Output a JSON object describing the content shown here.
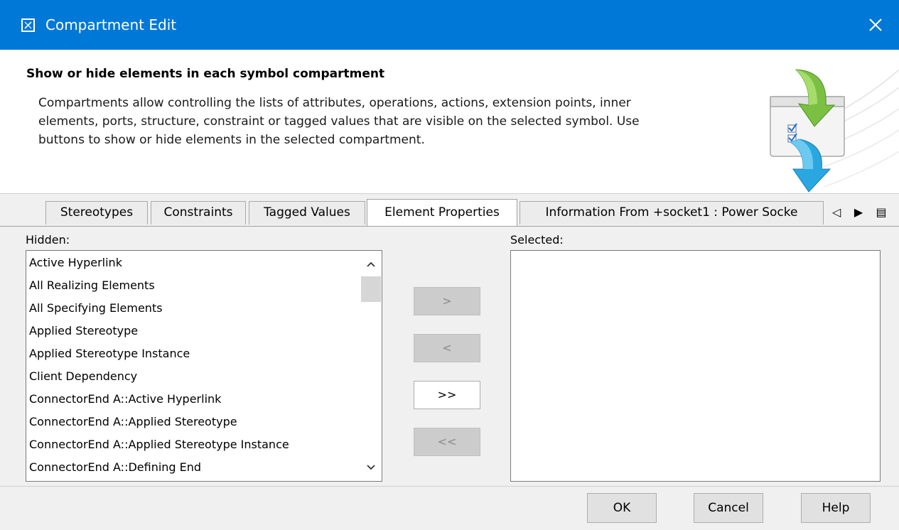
{
  "window": {
    "title": "Compartment Edit",
    "close_glyph": "✕"
  },
  "header": {
    "title": "Show or hide elements in each symbol compartment",
    "description_lines": [
      "Compartments allow controlling the lists of attributes, operations, actions, extension points, inner",
      "elements, ports, structure, constraint or tagged values that are visible on the selected symbol. Use",
      "buttons to show or hide elements in the selected compartment."
    ]
  },
  "tabs": [
    {
      "label": "Stereotypes",
      "active": false
    },
    {
      "label": "Constraints",
      "active": false
    },
    {
      "label": "Tagged Values",
      "active": false
    },
    {
      "label": "Element Properties",
      "active": true
    },
    {
      "label": "Information From +socket1 : Power Socke",
      "active": false
    }
  ],
  "tab_nav": {
    "prev_glyph": "◁",
    "next_glyph": "▶",
    "menu_glyph": "▤"
  },
  "hidden": {
    "label": "Hidden:",
    "items": [
      "Active Hyperlink",
      "All Realizing Elements",
      "All Specifying Elements",
      "Applied Stereotype",
      "Applied Stereotype Instance",
      "Client Dependency",
      "ConnectorEnd A::Active Hyperlink",
      "ConnectorEnd A::Applied Stereotype",
      "ConnectorEnd A::Applied Stereotype Instance",
      "ConnectorEnd A::Defining End"
    ]
  },
  "selected": {
    "label": "Selected:",
    "items": []
  },
  "move_buttons": {
    "add": ">",
    "remove": "<",
    "add_all": ">>",
    "remove_all": "<<"
  },
  "footer": {
    "ok": "OK",
    "cancel": "Cancel",
    "help": "Help"
  },
  "icons": {
    "title": "dialog-app-icon",
    "close": "close-icon",
    "header": "compartment-illustration-icon"
  }
}
